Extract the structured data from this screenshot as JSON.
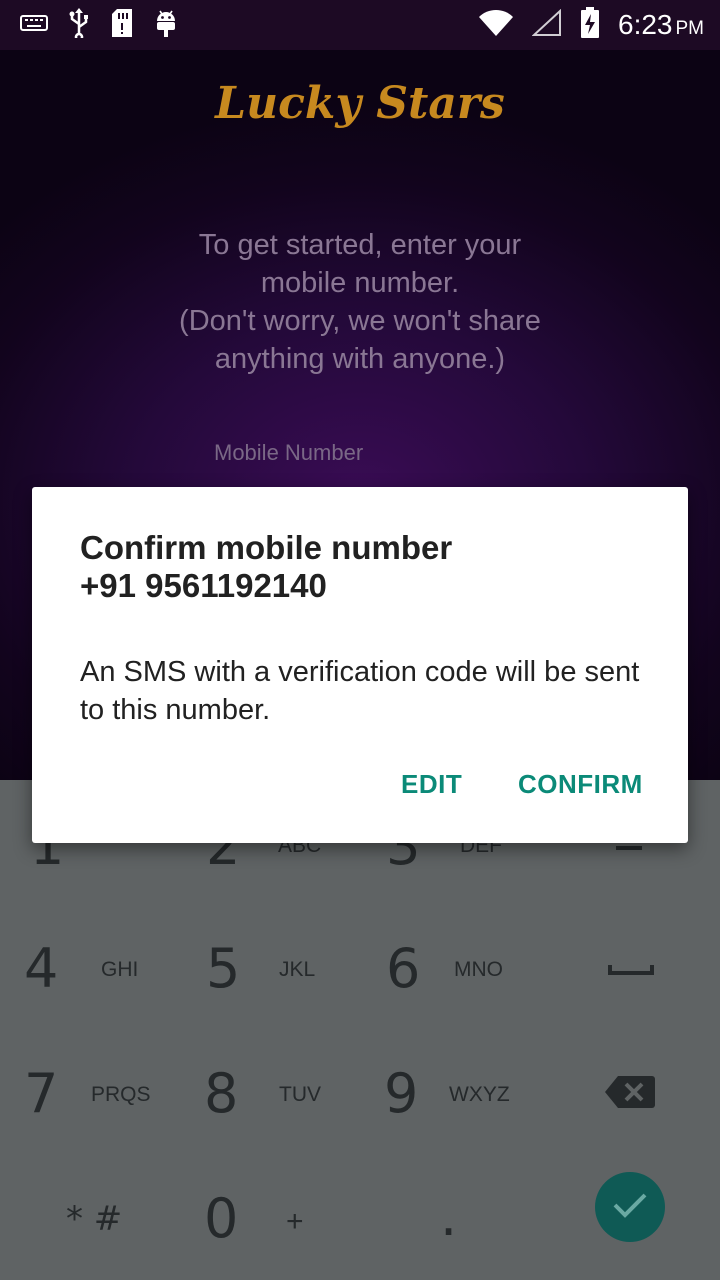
{
  "status_bar": {
    "time": "6:23",
    "ampm": "PM",
    "icons": [
      "keyboard-icon",
      "usb-icon",
      "sd-card-icon",
      "android-icon",
      "wifi-icon",
      "signal-icon",
      "battery-charging-icon"
    ]
  },
  "app": {
    "title": "Lucky Stars",
    "intro_line1": "To get started, enter your",
    "intro_line2": "mobile number.",
    "intro_line3": "(Don't worry, we won't share",
    "intro_line4": "anything with anyone.)",
    "field_label": "Mobile Number"
  },
  "dialog": {
    "title_line1": "Confirm mobile number",
    "title_line2": "+91 9561192140",
    "message": "An SMS with a verification code will be sent to this number.",
    "edit_label": "EDIT",
    "confirm_label": "CONFIRM"
  },
  "keypad": {
    "k1": "1",
    "k2": "2",
    "k2_letters": "ABC",
    "k3": "3",
    "k3_letters": "DEF",
    "k4": "4",
    "k4_letters": "GHI",
    "k5": "5",
    "k5_letters": "JKL",
    "k6": "6",
    "k6_letters": "MNO",
    "k7": "7",
    "k7_letters": "PRQS",
    "k8": "8",
    "k8_letters": "TUV",
    "k9": "9",
    "k9_letters": "WXYZ",
    "kstar": "* #",
    "k0": "0",
    "kplus": "+",
    "kdot": "."
  },
  "colors": {
    "accent": "#0b8a78",
    "title_gold": "#c7891f",
    "fab": "#0f5a55"
  }
}
